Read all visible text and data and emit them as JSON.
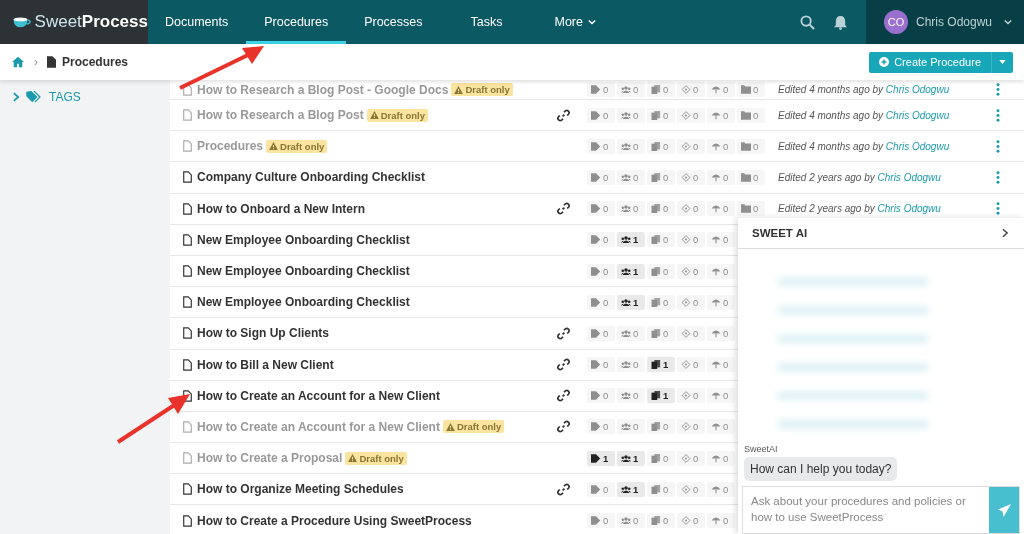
{
  "brand": {
    "light": "Sweet",
    "bold": "Process"
  },
  "nav": [
    {
      "label": "Documents",
      "selected": false,
      "dropdown": false
    },
    {
      "label": "Procedures",
      "selected": true,
      "dropdown": false
    },
    {
      "label": "Processes",
      "selected": false,
      "dropdown": false
    },
    {
      "label": "Tasks",
      "selected": false,
      "dropdown": false
    },
    {
      "label": "More",
      "selected": false,
      "dropdown": true
    }
  ],
  "user": {
    "initials": "CO",
    "name": "Chris Odogwu"
  },
  "breadcrumb": {
    "separator": "›",
    "current": "Procedures"
  },
  "create_button": "Create Procedure",
  "sidebar": {
    "items": [
      {
        "label": "TAGS",
        "expanded": false
      }
    ]
  },
  "rows": [
    {
      "title": "How to Research a Blog Post - Google Docs",
      "draft": true,
      "draft_label": "Draft only",
      "link": false,
      "counts": [
        {
          "kind": "tag",
          "value": "0",
          "highlighted": false
        },
        {
          "kind": "users",
          "value": "0",
          "highlighted": false
        },
        {
          "kind": "docs",
          "value": "0",
          "highlighted": false
        },
        {
          "kind": "approval",
          "value": "0",
          "highlighted": false
        },
        {
          "kind": "policy",
          "value": "0",
          "highlighted": false
        },
        {
          "kind": "folder",
          "value": "0",
          "highlighted": false
        }
      ],
      "edited": {
        "text": "Edited 4 months ago by",
        "author": "Chris Odogwu"
      }
    },
    {
      "title": "How to Research a Blog Post",
      "draft": true,
      "draft_label": "Draft only",
      "link": true,
      "counts": [
        {
          "kind": "tag",
          "value": "0",
          "highlighted": false
        },
        {
          "kind": "users",
          "value": "0",
          "highlighted": false
        },
        {
          "kind": "docs",
          "value": "0",
          "highlighted": false
        },
        {
          "kind": "approval",
          "value": "0",
          "highlighted": false
        },
        {
          "kind": "policy",
          "value": "0",
          "highlighted": false
        },
        {
          "kind": "folder",
          "value": "0",
          "highlighted": false
        }
      ],
      "edited": {
        "text": "Edited 4 months ago by",
        "author": "Chris Odogwu"
      }
    },
    {
      "title": "Procedures",
      "draft": true,
      "draft_label": "Draft only",
      "link": false,
      "counts": [
        {
          "kind": "tag",
          "value": "0",
          "highlighted": false
        },
        {
          "kind": "users",
          "value": "0",
          "highlighted": false
        },
        {
          "kind": "docs",
          "value": "0",
          "highlighted": false
        },
        {
          "kind": "approval",
          "value": "0",
          "highlighted": false
        },
        {
          "kind": "policy",
          "value": "0",
          "highlighted": false
        },
        {
          "kind": "folder",
          "value": "0",
          "highlighted": false
        }
      ],
      "edited": {
        "text": "Edited 4 months ago by",
        "author": "Chris Odogwu"
      }
    },
    {
      "title": "Company Culture Onboarding Checklist",
      "draft": false,
      "link": false,
      "counts": [
        {
          "kind": "tag",
          "value": "0",
          "highlighted": false
        },
        {
          "kind": "users",
          "value": "0",
          "highlighted": false
        },
        {
          "kind": "docs",
          "value": "0",
          "highlighted": false
        },
        {
          "kind": "approval",
          "value": "0",
          "highlighted": false
        },
        {
          "kind": "policy",
          "value": "0",
          "highlighted": false
        },
        {
          "kind": "folder",
          "value": "0",
          "highlighted": false
        }
      ],
      "edited": {
        "text": "Edited 2 years ago by",
        "author": "Chris Odogwu"
      }
    },
    {
      "title": "How to Onboard a New Intern",
      "draft": false,
      "link": true,
      "counts": [
        {
          "kind": "tag",
          "value": "0",
          "highlighted": false
        },
        {
          "kind": "users",
          "value": "0",
          "highlighted": false
        },
        {
          "kind": "docs",
          "value": "0",
          "highlighted": false
        },
        {
          "kind": "approval",
          "value": "0",
          "highlighted": false
        },
        {
          "kind": "policy",
          "value": "0",
          "highlighted": false
        },
        {
          "kind": "folder",
          "value": "0",
          "highlighted": false
        }
      ],
      "edited": {
        "text": "Edited 2 years ago by",
        "author": "Chris Odogwu"
      }
    },
    {
      "title": "New Employee Onboarding Checklist",
      "draft": false,
      "link": false,
      "counts": [
        {
          "kind": "tag",
          "value": "0",
          "highlighted": false
        },
        {
          "kind": "users",
          "value": "1",
          "highlighted": true
        },
        {
          "kind": "docs",
          "value": "0",
          "highlighted": false
        },
        {
          "kind": "approval",
          "value": "0",
          "highlighted": false
        },
        {
          "kind": "policy",
          "value": "0",
          "highlighted": false
        }
      ]
    },
    {
      "title": "New Employee Onboarding Checklist",
      "draft": false,
      "link": false,
      "counts": [
        {
          "kind": "tag",
          "value": "0",
          "highlighted": false
        },
        {
          "kind": "users",
          "value": "1",
          "highlighted": true
        },
        {
          "kind": "docs",
          "value": "0",
          "highlighted": false
        },
        {
          "kind": "approval",
          "value": "0",
          "highlighted": false
        },
        {
          "kind": "policy",
          "value": "0",
          "highlighted": false
        }
      ]
    },
    {
      "title": "New Employee Onboarding Checklist",
      "draft": false,
      "link": false,
      "counts": [
        {
          "kind": "tag",
          "value": "0",
          "highlighted": false
        },
        {
          "kind": "users",
          "value": "1",
          "highlighted": true
        },
        {
          "kind": "docs",
          "value": "0",
          "highlighted": false
        },
        {
          "kind": "approval",
          "value": "0",
          "highlighted": false
        },
        {
          "kind": "policy",
          "value": "0",
          "highlighted": false
        }
      ]
    },
    {
      "title": "How to Sign Up Clients",
      "draft": false,
      "link": true,
      "counts": [
        {
          "kind": "tag",
          "value": "0",
          "highlighted": false
        },
        {
          "kind": "users",
          "value": "0",
          "highlighted": false
        },
        {
          "kind": "docs",
          "value": "0",
          "highlighted": false
        },
        {
          "kind": "approval",
          "value": "0",
          "highlighted": false
        },
        {
          "kind": "policy",
          "value": "0",
          "highlighted": false
        }
      ]
    },
    {
      "title": "How to Bill a New Client",
      "draft": false,
      "link": true,
      "counts": [
        {
          "kind": "tag",
          "value": "0",
          "highlighted": false
        },
        {
          "kind": "users",
          "value": "0",
          "highlighted": false
        },
        {
          "kind": "docs",
          "value": "1",
          "highlighted": true
        },
        {
          "kind": "approval",
          "value": "0",
          "highlighted": false
        },
        {
          "kind": "policy",
          "value": "0",
          "highlighted": false
        }
      ]
    },
    {
      "title": "How to Create an Account for a New Client",
      "draft": false,
      "link": true,
      "counts": [
        {
          "kind": "tag",
          "value": "0",
          "highlighted": false
        },
        {
          "kind": "users",
          "value": "0",
          "highlighted": false
        },
        {
          "kind": "docs",
          "value": "1",
          "highlighted": true
        },
        {
          "kind": "approval",
          "value": "0",
          "highlighted": false
        },
        {
          "kind": "policy",
          "value": "0",
          "highlighted": false
        }
      ]
    },
    {
      "title": "How to Create an Account for a New Client",
      "draft": true,
      "draft_label": "Draft only",
      "link": true,
      "counts": [
        {
          "kind": "tag",
          "value": "0",
          "highlighted": false
        },
        {
          "kind": "users",
          "value": "0",
          "highlighted": false
        },
        {
          "kind": "docs",
          "value": "0",
          "highlighted": false
        },
        {
          "kind": "approval",
          "value": "0",
          "highlighted": false
        },
        {
          "kind": "policy",
          "value": "0",
          "highlighted": false
        }
      ]
    },
    {
      "title": "How to Create a Proposal",
      "draft": true,
      "draft_label": "Draft only",
      "link": false,
      "counts": [
        {
          "kind": "tag",
          "value": "1",
          "highlighted": true
        },
        {
          "kind": "users",
          "value": "1",
          "highlighted": true
        },
        {
          "kind": "docs",
          "value": "0",
          "highlighted": false
        },
        {
          "kind": "approval",
          "value": "0",
          "highlighted": false
        },
        {
          "kind": "policy",
          "value": "0",
          "highlighted": false
        }
      ]
    },
    {
      "title": "How to Organize Meeting Schedules",
      "draft": false,
      "link": true,
      "counts": [
        {
          "kind": "tag",
          "value": "0",
          "highlighted": false
        },
        {
          "kind": "users",
          "value": "1",
          "highlighted": true
        },
        {
          "kind": "docs",
          "value": "0",
          "highlighted": false
        },
        {
          "kind": "approval",
          "value": "0",
          "highlighted": false
        },
        {
          "kind": "policy",
          "value": "0",
          "highlighted": false
        }
      ]
    },
    {
      "title": "How to Create a Procedure Using SweetProcess",
      "draft": false,
      "link": false,
      "counts": [
        {
          "kind": "tag",
          "value": "0",
          "highlighted": false
        },
        {
          "kind": "users",
          "value": "0",
          "highlighted": false
        },
        {
          "kind": "docs",
          "value": "0",
          "highlighted": false
        },
        {
          "kind": "approval",
          "value": "0",
          "highlighted": false
        },
        {
          "kind": "policy",
          "value": "0",
          "highlighted": false
        }
      ]
    }
  ],
  "ai_panel": {
    "title": "SWEET AI",
    "sender": "SweetAI",
    "message": "How can I help you today?",
    "input": {
      "placeholder": "Ask about your procedures and policies or how to use SweetProcess"
    }
  }
}
